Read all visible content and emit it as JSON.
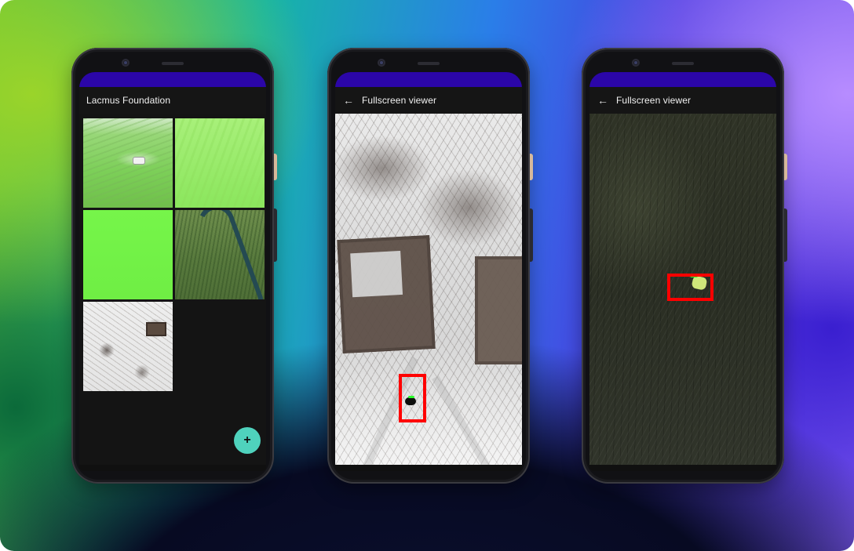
{
  "screens": [
    {
      "app_bar": {
        "title": "Lacmus Foundation"
      },
      "gallery": {
        "thumbnails": [
          {
            "icon": "thumbnail-field-house"
          },
          {
            "icon": "thumbnail-green-field"
          },
          {
            "icon": "thumbnail-green-solid"
          },
          {
            "icon": "thumbnail-river-field"
          },
          {
            "icon": "thumbnail-snow-trees"
          }
        ]
      },
      "fab": {
        "label": "+",
        "icon": "add-icon"
      }
    },
    {
      "app_bar": {
        "title": "Fullscreen viewer",
        "back_label": "←",
        "back_icon": "arrow-left-icon"
      },
      "viewer": {
        "image": "aerial-snow-forest",
        "detection_color": "#ff0000"
      }
    },
    {
      "app_bar": {
        "title": "Fullscreen viewer",
        "back_label": "←",
        "back_icon": "arrow-left-icon"
      },
      "viewer": {
        "image": "aerial-dark-field",
        "detection_color": "#ff0000"
      }
    }
  ],
  "colors": {
    "status_bar": "#2b06a8",
    "fab": "#4fd2bd",
    "screen_bg": "#141414",
    "detection_box": "#ff0000"
  }
}
